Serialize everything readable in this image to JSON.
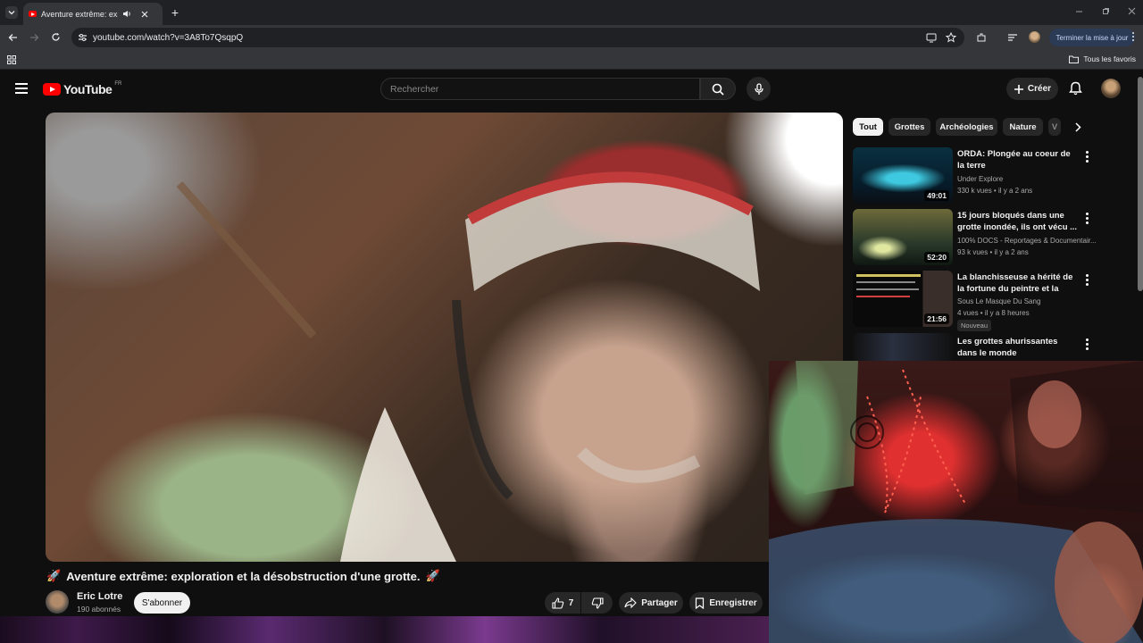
{
  "browser": {
    "tab_title": "Aventure extrême: exploration et la désobstruction d'une grotte.",
    "url": "youtube.com/watch?v=3A8To7QsqpQ",
    "update_button": "Terminer la mise à jour",
    "bookmarks_label": "Tous les favoris"
  },
  "header": {
    "logo_text": "YouTube",
    "logo_region": "FR",
    "search_placeholder": "Rechercher",
    "create_label": "Créer"
  },
  "video": {
    "title": "Aventure extrême: exploration et la désobstruction d'une grotte.",
    "channel": "Eric Lotre",
    "subscribers": "190 abonnés",
    "subscribe_label": "S'abonner",
    "likes": "7",
    "share_label": "Partager",
    "save_label": "Enregistrer"
  },
  "chips": [
    "Tout",
    "Grottes",
    "Archéologies",
    "Nature",
    "V"
  ],
  "recommendations": [
    {
      "title": "ORDA: Plongée au coeur de la terre",
      "channel": "Under Explore",
      "meta": "330 k vues • il y a 2 ans",
      "duration": "49:01"
    },
    {
      "title": "15 jours bloqués dans une grotte inondée, ils ont vécu ...",
      "channel": "100% DOCS - Reportages & Documentair...",
      "meta": "93 k vues • il y a 2 ans",
      "duration": "52:20"
    },
    {
      "title": "La blanchisseuse a hérité de la fortune du peintre et la famille...",
      "channel": "Sous Le Masque Du Sang",
      "meta": "4 vues • il y a 8 heures",
      "duration": "21:56",
      "badge": "Nouveau"
    },
    {
      "title": "Les grottes ahurissantes dans le monde",
      "channel": "",
      "meta": "",
      "duration": ""
    }
  ]
}
